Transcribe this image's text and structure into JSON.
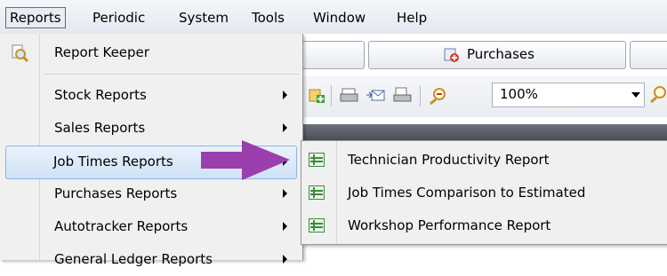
{
  "menubar": {
    "items": [
      "Reports",
      "Periodic",
      "System",
      "Tools",
      "Window",
      "Help"
    ]
  },
  "reports_menu": {
    "items": [
      {
        "label": "Report Keeper",
        "submenu": false,
        "icon": "magnifier-report-icon"
      },
      {
        "label": "Stock Reports",
        "submenu": true
      },
      {
        "label": "Sales Reports",
        "submenu": true
      },
      {
        "label": "Job Times Reports",
        "submenu": true,
        "highlighted": true
      },
      {
        "label": "Purchases Reports",
        "submenu": true
      },
      {
        "label": "Autotracker Reports",
        "submenu": true
      },
      {
        "label": "General Ledger Reports",
        "submenu": true
      }
    ]
  },
  "job_times_submenu": {
    "items": [
      {
        "label": "Technician Productivity Report",
        "icon": "report-grid-icon"
      },
      {
        "label": "Job Times Comparison to Estimated",
        "icon": "report-grid-icon"
      },
      {
        "label": "Workshop Performance Report",
        "icon": "report-grid-icon"
      }
    ]
  },
  "background": {
    "purchases_tab": "Purchases",
    "zoom": "100%"
  },
  "colors": {
    "highlight": "#cfe2f7",
    "annotation_arrow": "#9b3fae"
  }
}
